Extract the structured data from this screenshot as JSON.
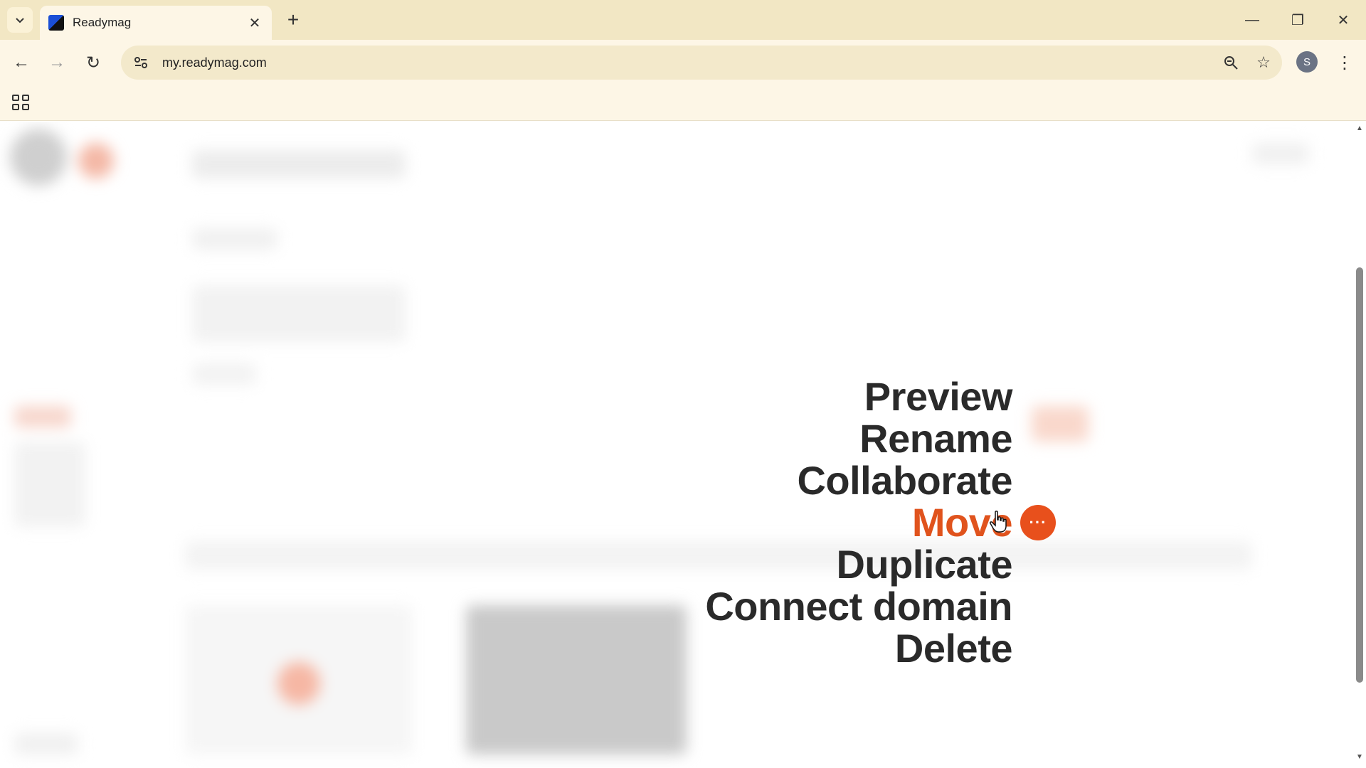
{
  "browser": {
    "tab_title": "Readymag",
    "url": "my.readymag.com",
    "profile_initial": "S"
  },
  "menu": {
    "items": [
      {
        "label": "Preview",
        "active": false
      },
      {
        "label": "Rename",
        "active": false
      },
      {
        "label": "Collaborate",
        "active": false
      },
      {
        "label": "Move",
        "active": true
      },
      {
        "label": "Duplicate",
        "active": false
      },
      {
        "label": "Connect domain",
        "active": false
      },
      {
        "label": "Delete",
        "active": false
      }
    ],
    "more_button_glyph": "···"
  },
  "colors": {
    "accent": "#e0531d",
    "menu_text": "#2a2a2a",
    "chrome_bg": "#fdf6e6"
  }
}
